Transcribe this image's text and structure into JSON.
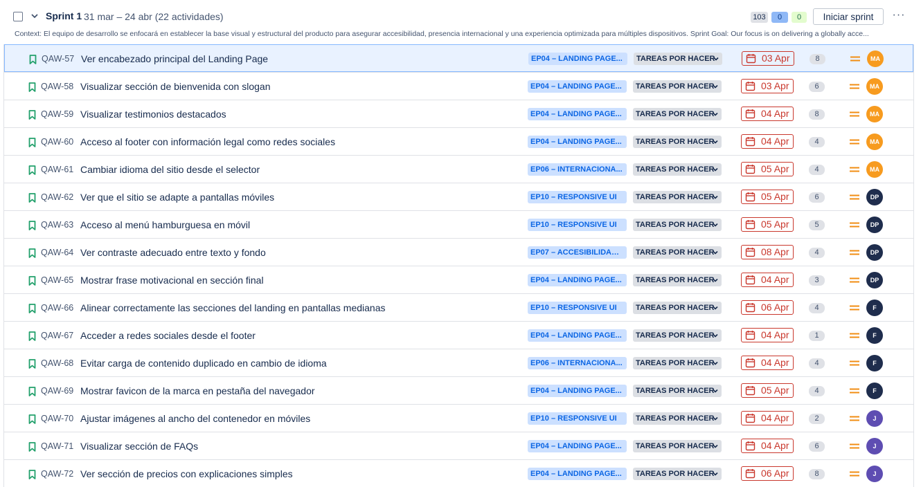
{
  "sprint": {
    "name": "Sprint 1",
    "dates": "31 mar – 24 abr (22 actividades)",
    "counts": {
      "todo": "103",
      "in_progress": "0",
      "done": "0"
    },
    "start_button": "Iniciar sprint",
    "more_label": "···",
    "context": "Context: El equipo de desarrollo se enfocará en establecer la base visual y estructural del producto para asegurar accesibilidad, presencia internacional y una experiencia optimizada para múltiples dispositivos. Sprint Goal: Our focus is on delivering a globally acce..."
  },
  "colors": {
    "epic_bg": "#cce0ff",
    "epic_text": "#0c66e4",
    "due_red": "#c9372c",
    "bookmark_green": "#22a06b",
    "priority_orange": "#f18d13",
    "avatar_ma": "#f79b1f",
    "avatar_dp": "#1f2d4d",
    "avatar_f": "#1f2d4d",
    "avatar_j": "#5e4db2"
  },
  "issues": [
    {
      "key": "QAW-57",
      "summary": "Ver encabezado principal del Landing Page",
      "epic": "EP04 – LANDING PAGE...",
      "status": "TAREAS POR HACER",
      "due": "03 Apr",
      "points": "8",
      "assignee": "MA",
      "avatar_color": "#f79b1f",
      "selected": true,
      "priority_icon": "priority-medium-icon"
    },
    {
      "key": "QAW-58",
      "summary": "Visualizar sección de bienvenida con slogan",
      "epic": "EP04 – LANDING PAGE...",
      "status": "TAREAS POR HACER",
      "due": "03 Apr",
      "points": "6",
      "assignee": "MA",
      "avatar_color": "#f79b1f",
      "priority_icon": "priority-medium-icon"
    },
    {
      "key": "QAW-59",
      "summary": "Visualizar testimonios destacados",
      "epic": "EP04 – LANDING PAGE...",
      "status": "TAREAS POR HACER",
      "due": "04 Apr",
      "points": "8",
      "assignee": "MA",
      "avatar_color": "#f79b1f",
      "priority_icon": "priority-medium-icon"
    },
    {
      "key": "QAW-60",
      "summary": "Acceso al footer con información legal como redes sociales",
      "epic": "EP04 – LANDING PAGE...",
      "status": "TAREAS POR HACER",
      "due": "04 Apr",
      "points": "4",
      "assignee": "MA",
      "avatar_color": "#f79b1f",
      "priority_icon": "priority-medium-icon"
    },
    {
      "key": "QAW-61",
      "summary": "Cambiar idioma del sitio desde el selector",
      "epic": "EP06 – INTERNACIONA...",
      "status": "TAREAS POR HACER",
      "due": "05 Apr",
      "points": "4",
      "assignee": "MA",
      "avatar_color": "#f79b1f",
      "priority_icon": "priority-medium-icon"
    },
    {
      "key": "QAW-62",
      "summary": "Ver que el sitio se adapte a pantallas móviles",
      "epic": "EP10 – RESPONSIVE UI",
      "status": "TAREAS POR HACER",
      "due": "05 Apr",
      "points": "6",
      "assignee": "DP",
      "avatar_color": "#1f2d4d",
      "priority_icon": "priority-medium-icon"
    },
    {
      "key": "QAW-63",
      "summary": "Acceso al menú hamburguesa en móvil",
      "epic": "EP10 – RESPONSIVE UI",
      "status": "TAREAS POR HACER",
      "due": "05 Apr",
      "points": "5",
      "assignee": "DP",
      "avatar_color": "#1f2d4d",
      "priority_icon": "priority-medium-icon"
    },
    {
      "key": "QAW-64",
      "summary": "Ver contraste adecuado entre texto y fondo",
      "epic": "EP07 – ACCESIBILIDAD ...",
      "status": "TAREAS POR HACER",
      "due": "08 Apr",
      "points": "4",
      "assignee": "DP",
      "avatar_color": "#1f2d4d",
      "priority_icon": "priority-medium-icon"
    },
    {
      "key": "QAW-65",
      "summary": "Mostrar frase motivacional en sección final",
      "epic": "EP04 – LANDING PAGE...",
      "status": "TAREAS POR HACER",
      "due": "04 Apr",
      "points": "3",
      "assignee": "DP",
      "avatar_color": "#1f2d4d",
      "priority_icon": "priority-medium-icon"
    },
    {
      "key": "QAW-66",
      "summary": "Alinear correctamente las secciones del landing en pantallas medianas",
      "epic": "EP10 – RESPONSIVE UI",
      "status": "TAREAS POR HACER",
      "due": "06 Apr",
      "points": "4",
      "assignee": "F",
      "avatar_color": "#1f2d4d",
      "priority_icon": "priority-medium-icon"
    },
    {
      "key": "QAW-67",
      "summary": "Acceder a redes sociales desde el footer",
      "epic": "EP04 – LANDING PAGE...",
      "status": "TAREAS POR HACER",
      "due": "04 Apr",
      "points": "1",
      "assignee": "F",
      "avatar_color": "#1f2d4d",
      "priority_icon": "priority-medium-icon"
    },
    {
      "key": "QAW-68",
      "summary": "Evitar carga de contenido duplicado en cambio de idioma",
      "epic": "EP06 – INTERNACIONA...",
      "status": "TAREAS POR HACER",
      "due": "04 Apr",
      "points": "4",
      "assignee": "F",
      "avatar_color": "#1f2d4d",
      "priority_icon": "priority-medium-icon"
    },
    {
      "key": "QAW-69",
      "summary": "Mostrar favicon de la marca en pestaña del navegador",
      "epic": "EP04 – LANDING PAGE...",
      "status": "TAREAS POR HACER",
      "due": "05 Apr",
      "points": "4",
      "assignee": "F",
      "avatar_color": "#1f2d4d",
      "priority_icon": "priority-medium-icon"
    },
    {
      "key": "QAW-70",
      "summary": "Ajustar imágenes al ancho del contenedor en móviles",
      "epic": "EP10 – RESPONSIVE UI",
      "status": "TAREAS POR HACER",
      "due": "04 Apr",
      "points": "2",
      "assignee": "J",
      "avatar_color": "#5e4db2",
      "priority_icon": "priority-medium-icon"
    },
    {
      "key": "QAW-71",
      "summary": "Visualizar sección de FAQs",
      "epic": "EP04 – LANDING PAGE...",
      "status": "TAREAS POR HACER",
      "due": "04 Apr",
      "points": "6",
      "assignee": "J",
      "avatar_color": "#5e4db2",
      "priority_icon": "priority-medium-icon"
    },
    {
      "key": "QAW-72",
      "summary": "Ver sección de precios con explicaciones simples",
      "epic": "EP04 – LANDING PAGE...",
      "status": "TAREAS POR HACER",
      "due": "06 Apr",
      "points": "8",
      "assignee": "J",
      "avatar_color": "#5e4db2",
      "priority_icon": "priority-medium-icon"
    }
  ]
}
